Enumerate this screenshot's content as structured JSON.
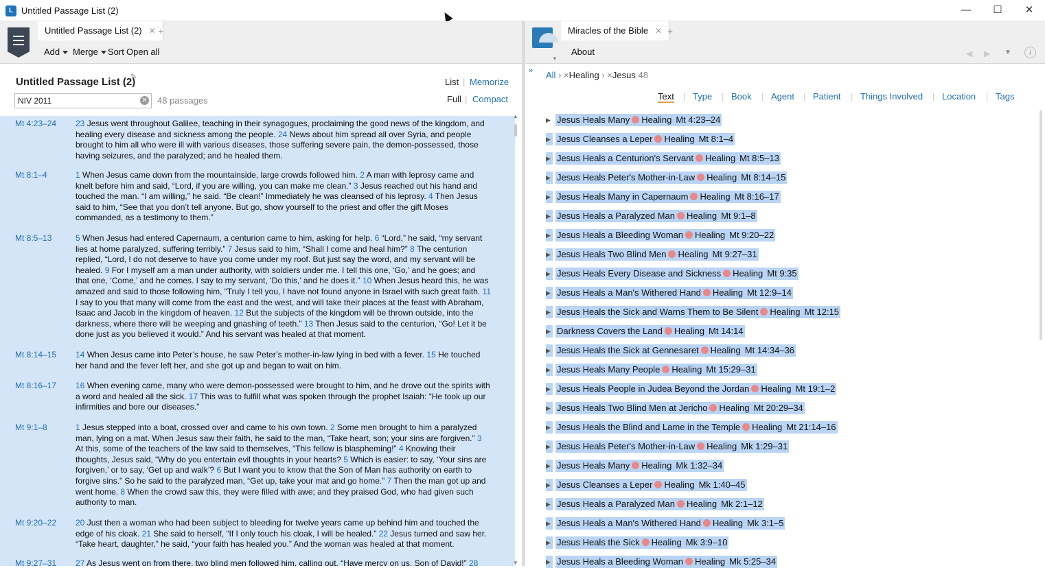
{
  "window": {
    "title": "Untitled Passage List (2)",
    "minimize": "—",
    "maximize": "☐",
    "close": "✕"
  },
  "left": {
    "tab": "Untitled Passage List (2)",
    "toolbar": {
      "add": "Add",
      "merge": "Merge",
      "sort": "Sort",
      "open_all": "Open all"
    },
    "heading": "Untitled Passage List (2)",
    "view_list": "List",
    "view_memorize": "Memorize",
    "mode_full": "Full",
    "mode_compact": "Compact",
    "version": "NIV 2011",
    "count": "48 passages",
    "passages": [
      {
        "ref": "Mt 4:23–24",
        "verses": [
          {
            "n": "23",
            "t": " Jesus went throughout Galilee, teaching in their synagogues, proclaiming the good news of the kingdom, and healing every disease and sickness among the people. "
          },
          {
            "n": "24",
            "t": " News about him spread all over Syria, and people brought to him all who were ill with various diseases, those suffering severe pain, the demon-possessed, those having seizures, and the paralyzed; and he healed them."
          }
        ]
      },
      {
        "ref": "Mt 8:1–4",
        "verses": [
          {
            "n": "1",
            "t": " When Jesus came down from the mountainside, large crowds followed him. "
          },
          {
            "n": "2",
            "t": " A man with leprosy came and knelt before him and said, “Lord, if you are willing, you can make me clean.” "
          },
          {
            "n": "3",
            "t": " Jesus reached out his hand and touched the man. “I am willing,” he said. “Be clean!” Immediately he was cleansed of his leprosy. "
          },
          {
            "n": "4",
            "t": " Then Jesus said to him, “See that you don’t tell anyone. But go, show yourself to the priest and offer the gift Moses commanded, as a testimony to them.”"
          }
        ]
      },
      {
        "ref": "Mt 8:5–13",
        "verses": [
          {
            "n": "5",
            "t": " When Jesus had entered Capernaum, a centurion came to him, asking for help. "
          },
          {
            "n": "6",
            "t": " “Lord,” he said, “my servant lies at home paralyzed, suffering terribly.” "
          },
          {
            "n": "7",
            "t": " Jesus said to him, “Shall I come and heal him?” "
          },
          {
            "n": "8",
            "t": " The centurion replied, “Lord, I do not deserve to have you come under my roof. But just say the word, and my servant will be healed. "
          },
          {
            "n": "9",
            "t": " For I myself am a man under authority, with soldiers under me. I tell this one, ‘Go,’ and he goes; and that one, ‘Come,’ and he comes. I say to my servant, ‘Do this,’ and he does it.” "
          },
          {
            "n": "10",
            "t": " When Jesus heard this, he was amazed and said to those following him, “Truly I tell you, I have not found anyone in Israel with such great faith. "
          },
          {
            "n": "11",
            "t": " I say to you that many will come from the east and the west, and will take their places at the feast with Abraham, Isaac and Jacob in the kingdom of heaven. "
          },
          {
            "n": "12",
            "t": " But the subjects of the kingdom will be thrown outside, into the darkness, where there will be weeping and gnashing of teeth.” "
          },
          {
            "n": "13",
            "t": " Then Jesus said to the centurion, “Go! Let it be done just as you believed it would.” And his servant was healed at that moment."
          }
        ]
      },
      {
        "ref": "Mt 8:14–15",
        "verses": [
          {
            "n": "14",
            "t": " When Jesus came into Peter’s house, he saw Peter’s mother-in-law lying in bed with a fever. "
          },
          {
            "n": "15",
            "t": " He touched her hand and the fever left her, and she got up and began to wait on him."
          }
        ]
      },
      {
        "ref": "Mt 8:16–17",
        "verses": [
          {
            "n": "16",
            "t": " When evening came, many who were demon-possessed were brought to him, and he drove out the spirits with a word and healed all the sick. "
          },
          {
            "n": "17",
            "t": " This was to fulfill what was spoken through the prophet Isaiah: “He took up our infirmities and bore our diseases.”"
          }
        ]
      },
      {
        "ref": "Mt 9:1–8",
        "verses": [
          {
            "n": "1",
            "t": " Jesus stepped into a boat, crossed over and came to his own town. "
          },
          {
            "n": "2",
            "t": " Some men brought to him a paralyzed man, lying on a mat. When Jesus saw their faith, he said to the man, “Take heart, son; your sins are forgiven.” "
          },
          {
            "n": "3",
            "t": " At this, some of the teachers of the law said to themselves, “This fellow is blaspheming!” "
          },
          {
            "n": "4",
            "t": " Knowing their thoughts, Jesus said, “Why do you entertain evil thoughts in your hearts? "
          },
          {
            "n": "5",
            "t": " Which is easier: to say, ‘Your sins are forgiven,’ or to say, ‘Get up and walk’? "
          },
          {
            "n": "6",
            "t": " But I want you to know that the Son of Man has authority on earth to forgive sins.” So he said to the paralyzed man, “Get up, take your mat and go home.” "
          },
          {
            "n": "7",
            "t": " Then the man got up and went home. "
          },
          {
            "n": "8",
            "t": " When the crowd saw this, they were filled with awe; and they praised God, who had given such authority to man."
          }
        ]
      },
      {
        "ref": "Mt 9:20–22",
        "verses": [
          {
            "n": "20",
            "t": " Just then a woman who had been subject to bleeding for twelve years came up behind him and touched the edge of his cloak. "
          },
          {
            "n": "21",
            "t": " She said to herself, “If I only touch his cloak, I will be healed.” "
          },
          {
            "n": "22",
            "t": " Jesus turned and saw her. “Take heart, daughter,” he said, “your faith has healed you.” And the woman was healed at that moment."
          }
        ]
      },
      {
        "ref": "Mt 9:27–31",
        "verses": [
          {
            "n": "27",
            "t": " As Jesus went on from there, two blind men followed him, calling out, “Have mercy on us, Son of David!” "
          },
          {
            "n": "28",
            "t": ""
          }
        ]
      }
    ]
  },
  "right": {
    "tab": "Miracles of the Bible",
    "about": "About",
    "nav": {
      "back": "◀",
      "forward": "▶",
      "menu": "▼",
      "info": "i"
    },
    "expand": "»",
    "crumbs": {
      "all": "All",
      "x": "×",
      "healing": "Healing",
      "jesus": "Jesus",
      "count": "48"
    },
    "filters": [
      "Text",
      "Type",
      "Book",
      "Agent",
      "Patient",
      "Things Involved",
      "Location",
      "Tags"
    ],
    "items": [
      {
        "title": "Jesus Heals Many",
        "type": "Healing",
        "ref": "Mt 4:23–24"
      },
      {
        "title": "Jesus Cleanses a Leper",
        "type": "Healing",
        "ref": "Mt 8:1–4"
      },
      {
        "title": "Jesus Heals a Centurion's Servant",
        "type": "Healing",
        "ref": "Mt 8:5–13"
      },
      {
        "title": "Jesus Heals Peter's Mother-in-Law",
        "type": "Healing",
        "ref": "Mt 8:14–15"
      },
      {
        "title": "Jesus Heals Many in Capernaum",
        "type": "Healing",
        "ref": "Mt 8:16–17"
      },
      {
        "title": "Jesus Heals a Paralyzed Man",
        "type": "Healing",
        "ref": "Mt 9:1–8"
      },
      {
        "title": "Jesus Heals a Bleeding Woman",
        "type": "Healing",
        "ref": "Mt 9:20–22"
      },
      {
        "title": "Jesus Heals Two Blind Men",
        "type": "Healing",
        "ref": "Mt 9:27–31"
      },
      {
        "title": "Jesus Heals Every Disease and Sickness",
        "type": "Healing",
        "ref": "Mt 9:35"
      },
      {
        "title": "Jesus Heals a Man's Withered Hand",
        "type": "Healing",
        "ref": "Mt 12:9–14"
      },
      {
        "title": "Jesus Heals the Sick and Warns Them to Be Silent",
        "type": "Healing",
        "ref": "Mt 12:15"
      },
      {
        "title": "Darkness Covers the Land",
        "type": "Healing",
        "ref": "Mt 14:14"
      },
      {
        "title": "Jesus Heals the Sick at Gennesaret",
        "type": "Healing",
        "ref": "Mt 14:34–36"
      },
      {
        "title": "Jesus Heals Many People",
        "type": "Healing",
        "ref": "Mt 15:29–31"
      },
      {
        "title": "Jesus Heals People in Judea Beyond the Jordan",
        "type": "Healing",
        "ref": "Mt 19:1–2"
      },
      {
        "title": "Jesus Heals Two Blind Men at Jericho",
        "type": "Healing",
        "ref": "Mt 20:29–34"
      },
      {
        "title": "Jesus Heals the Blind and Lame in the Temple",
        "type": "Healing",
        "ref": "Mt 21:14–16"
      },
      {
        "title": "Jesus Heals Peter's Mother-in-Law",
        "type": "Healing",
        "ref": "Mk 1:29–31"
      },
      {
        "title": "Jesus Heals Many",
        "type": "Healing",
        "ref": "Mk 1:32–34"
      },
      {
        "title": "Jesus Cleanses a Leper",
        "type": "Healing",
        "ref": "Mk 1:40–45"
      },
      {
        "title": "Jesus Heals a Paralyzed Man",
        "type": "Healing",
        "ref": "Mk 2:1–12"
      },
      {
        "title": "Jesus Heals a Man's Withered Hand",
        "type": "Healing",
        "ref": "Mk 3:1–5"
      },
      {
        "title": "Jesus Heals the Sick",
        "type": "Healing",
        "ref": "Mk 3:9–10"
      },
      {
        "title": "Jesus Heals a Bleeding Woman",
        "type": "Healing",
        "ref": "Mk 5:25–34"
      }
    ]
  }
}
